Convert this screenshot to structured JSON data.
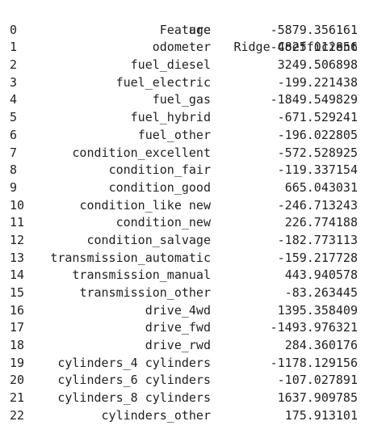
{
  "table": {
    "header": {
      "feature": "Feature",
      "coefficient": "Ridge Coefficient"
    },
    "rows": [
      {
        "index": "0",
        "feature": "age",
        "coefficient": "-5879.356161"
      },
      {
        "index": "1",
        "feature": "odometer",
        "coefficient": "-4825.012856"
      },
      {
        "index": "2",
        "feature": "fuel_diesel",
        "coefficient": "3249.506898"
      },
      {
        "index": "3",
        "feature": "fuel_electric",
        "coefficient": "-199.221438"
      },
      {
        "index": "4",
        "feature": "fuel_gas",
        "coefficient": "-1849.549829"
      },
      {
        "index": "5",
        "feature": "fuel_hybrid",
        "coefficient": "-671.529241"
      },
      {
        "index": "6",
        "feature": "fuel_other",
        "coefficient": "-196.022805"
      },
      {
        "index": "7",
        "feature": "condition_excellent",
        "coefficient": "-572.528925"
      },
      {
        "index": "8",
        "feature": "condition_fair",
        "coefficient": "-119.337154"
      },
      {
        "index": "9",
        "feature": "condition_good",
        "coefficient": "665.043031"
      },
      {
        "index": "10",
        "feature": "condition_like new",
        "coefficient": "-246.713243"
      },
      {
        "index": "11",
        "feature": "condition_new",
        "coefficient": "226.774188"
      },
      {
        "index": "12",
        "feature": "condition_salvage",
        "coefficient": "-182.773113"
      },
      {
        "index": "13",
        "feature": "transmission_automatic",
        "coefficient": "-159.217728"
      },
      {
        "index": "14",
        "feature": "transmission_manual",
        "coefficient": "443.940578"
      },
      {
        "index": "15",
        "feature": "transmission_other",
        "coefficient": "-83.263445"
      },
      {
        "index": "16",
        "feature": "drive_4wd",
        "coefficient": "1395.358409"
      },
      {
        "index": "17",
        "feature": "drive_fwd",
        "coefficient": "-1493.976321"
      },
      {
        "index": "18",
        "feature": "drive_rwd",
        "coefficient": "284.360176"
      },
      {
        "index": "19",
        "feature": "cylinders_4 cylinders",
        "coefficient": "-1178.129156"
      },
      {
        "index": "20",
        "feature": "cylinders_6 cylinders",
        "coefficient": "-107.027891"
      },
      {
        "index": "21",
        "feature": "cylinders_8 cylinders",
        "coefficient": "1637.909785"
      },
      {
        "index": "22",
        "feature": "cylinders_other",
        "coefficient": "175.913101"
      }
    ]
  }
}
